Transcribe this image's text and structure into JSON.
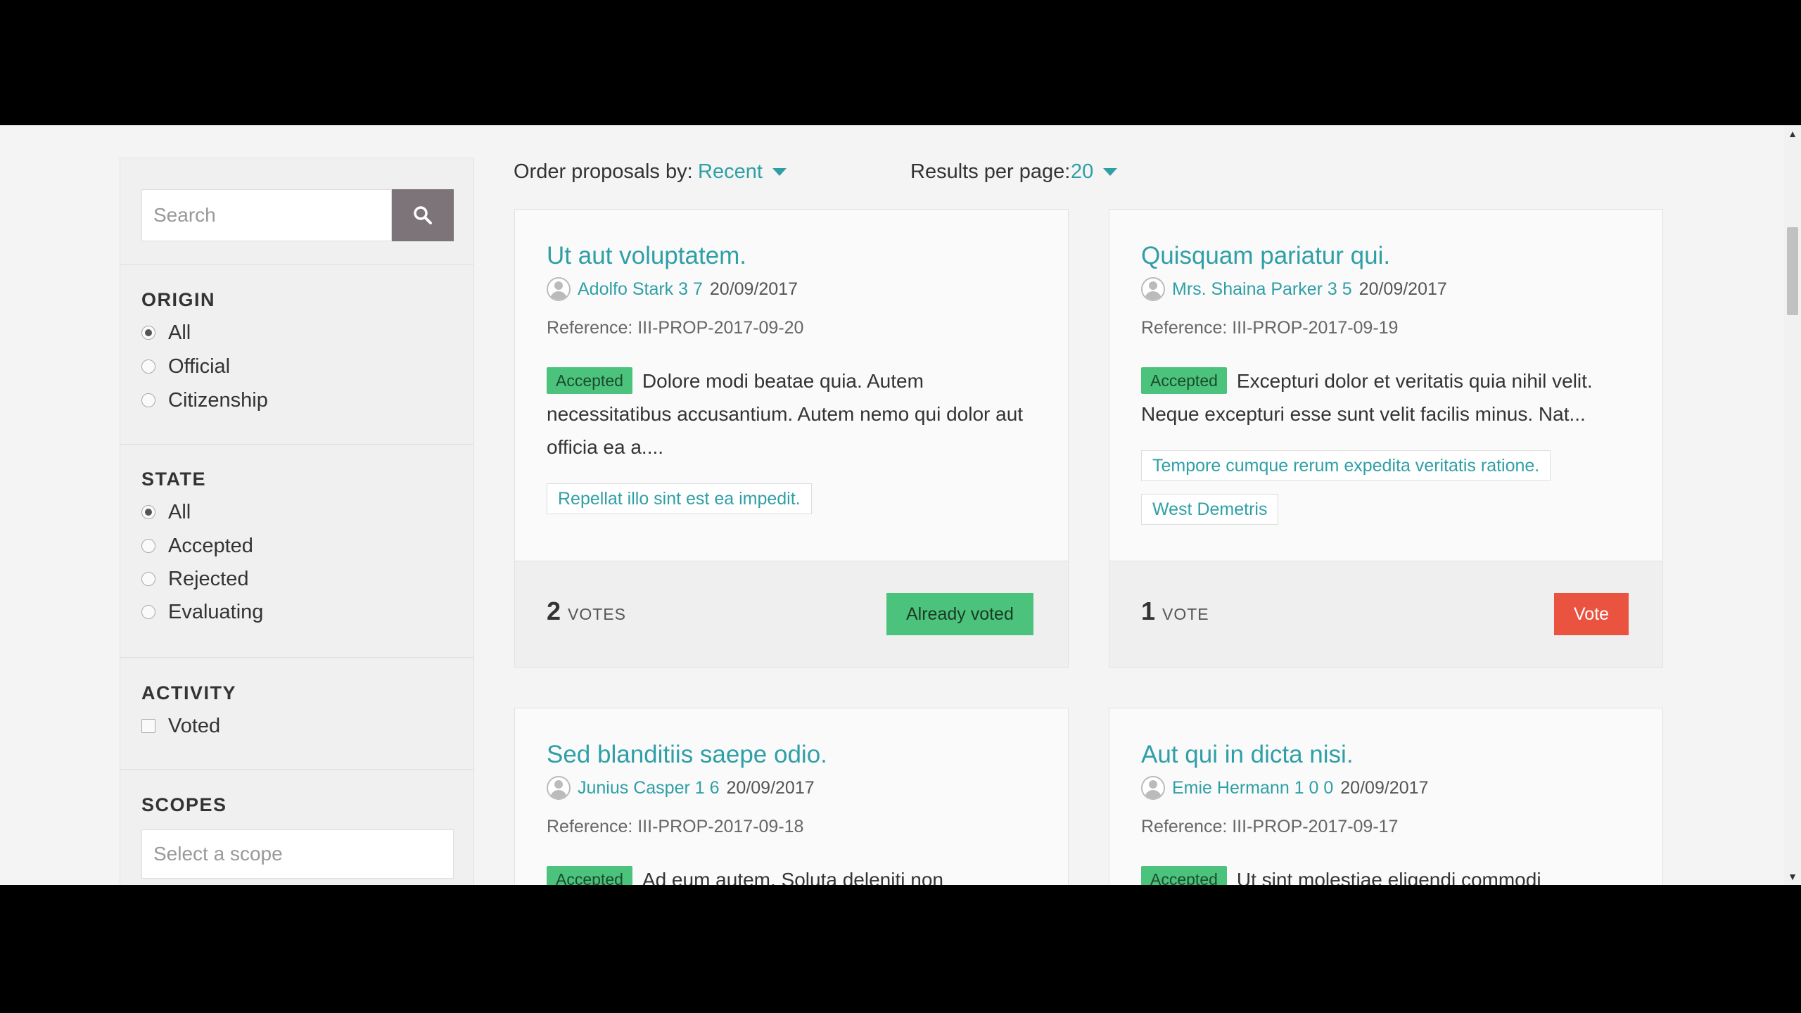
{
  "search": {
    "placeholder": "Search"
  },
  "filters": {
    "origin": {
      "title": "ORIGIN",
      "options": [
        "All",
        "Official",
        "Citizenship"
      ],
      "selected": "All"
    },
    "state": {
      "title": "STATE",
      "options": [
        "All",
        "Accepted",
        "Rejected",
        "Evaluating"
      ],
      "selected": "All"
    },
    "activity": {
      "title": "ACTIVITY",
      "options": [
        "Voted"
      ]
    },
    "scopes": {
      "title": "SCOPES",
      "placeholder": "Select a scope"
    }
  },
  "toolbar": {
    "order_label": "Order proposals by:",
    "order_value": "Recent",
    "per_page_label": "Results per page:",
    "per_page_value": "20"
  },
  "proposals": [
    {
      "title": "Ut aut voluptatem.",
      "author": "Adolfo Stark 3 7",
      "date": "20/09/2017",
      "reference": "Reference: III-PROP-2017-09-20",
      "status": "Accepted",
      "body": "Dolore modi beatae quia. Autem necessitatibus accusantium. Autem nemo qui dolor aut officia ea a....",
      "tags": [
        "Repellat illo sint est ea impedit."
      ],
      "votes": "2",
      "votes_label": "VOTES",
      "button": "Already voted"
    },
    {
      "title": "Quisquam pariatur qui.",
      "author": "Mrs. Shaina Parker 3 5",
      "date": "20/09/2017",
      "reference": "Reference: III-PROP-2017-09-19",
      "status": "Accepted",
      "body": "Excepturi dolor et veritatis quia nihil velit. Neque excepturi esse sunt velit facilis minus. Nat...",
      "tags": [
        "Tempore cumque rerum expedita veritatis ratione.",
        "West Demetris"
      ],
      "votes": "1",
      "votes_label": "VOTE",
      "button": "Vote"
    },
    {
      "title": "Sed blanditiis saepe odio.",
      "author": "Junius Casper 1 6",
      "date": "20/09/2017",
      "reference": "Reference: III-PROP-2017-09-18",
      "status": "Accepted",
      "body": "Ad eum autem. Soluta deleniti non"
    },
    {
      "title": "Aut qui in dicta nisi.",
      "author": "Emie Hermann 1 0 0",
      "date": "20/09/2017",
      "reference": "Reference: III-PROP-2017-09-17",
      "status": "Accepted",
      "body": "Ut sint molestiae eligendi commodi"
    }
  ],
  "colors": {
    "accent": "#2f9fa6",
    "accepted": "#4cc37c",
    "vote": "#e9533f",
    "search_button": "#7c7479"
  },
  "icons": {
    "search": "search-icon",
    "scroll_up": "arrow-up-icon",
    "scroll_down": "arrow-down-icon"
  }
}
